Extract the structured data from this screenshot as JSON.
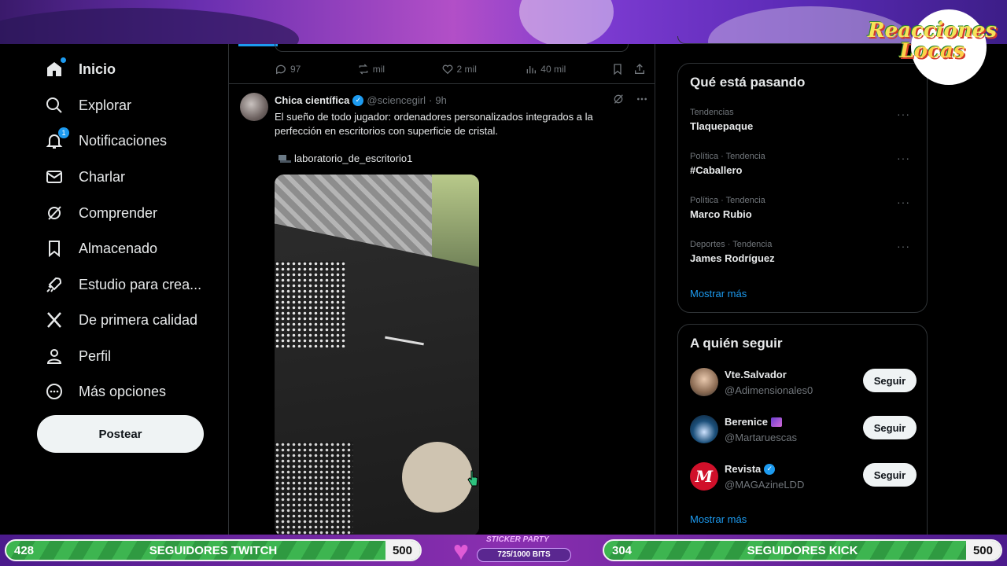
{
  "logo": {
    "line1": "Reacciones",
    "line2": "Locas"
  },
  "nav": {
    "items": [
      {
        "label": "Inicio",
        "icon": "home-icon"
      },
      {
        "label": "Explorar",
        "icon": "search-icon"
      },
      {
        "label": "Notificaciones",
        "icon": "bell-icon",
        "badge": "1"
      },
      {
        "label": "Charlar",
        "icon": "mail-icon"
      },
      {
        "label": "Comprender",
        "icon": "grok-icon"
      },
      {
        "label": "Almacenado",
        "icon": "bookmark-icon"
      },
      {
        "label": "Estudio para crea...",
        "icon": "rocket-icon"
      },
      {
        "label": "De primera calidad",
        "icon": "x-logo-icon"
      },
      {
        "label": "Perfil",
        "icon": "person-icon"
      },
      {
        "label": "Más opciones",
        "icon": "more-circle-icon"
      }
    ],
    "post_button": "Postear"
  },
  "prev_tweet_actions": {
    "replies": "97",
    "reposts": "mil",
    "likes": "2 mil",
    "views": "40 mil"
  },
  "tweet": {
    "name": "Chica científica",
    "handle": "@sciencegirl",
    "separator": "·",
    "time": "9h",
    "text": "El sueño de todo jugador: ordenadores personalizados integrados a la perfección en escritorios con superficie de cristal.",
    "tag": "laboratorio_de_escritorio1"
  },
  "trends": {
    "title": "Qué está pasando",
    "items": [
      {
        "context": "Tendencias",
        "title": "Tlaquepaque"
      },
      {
        "context": "Política · Tendencia",
        "title": "#Caballero"
      },
      {
        "context": "Política · Tendencia",
        "title": "Marco Rubio"
      },
      {
        "context": "Deportes · Tendencia",
        "title": "James Rodríguez"
      }
    ],
    "show_more": "Mostrar más"
  },
  "who_to_follow": {
    "title": "A quién seguir",
    "items": [
      {
        "name": "Vte.Salvador",
        "handle": "@Adimensionales0",
        "button": "Seguir"
      },
      {
        "name": "Berenice",
        "handle": "@Martaruescas",
        "button": "Seguir"
      },
      {
        "name": "Revista",
        "handle": "@MAGAzineLDD",
        "button": "Seguir",
        "avatar_letter": "M"
      }
    ],
    "show_more": "Mostrar más"
  },
  "overlay": {
    "twitch": {
      "current": "428",
      "label": "SEGUIDORES TWITCH",
      "goal": "500"
    },
    "sticker": {
      "title": "STICKER PARTY",
      "progress": "725/1000 BITS"
    },
    "kick": {
      "current": "304",
      "label": "SEGUIDORES KICK",
      "goal": "500"
    }
  },
  "colors": {
    "accent": "#1d9bf0",
    "background": "#000000",
    "goal_green": "#3db550"
  }
}
